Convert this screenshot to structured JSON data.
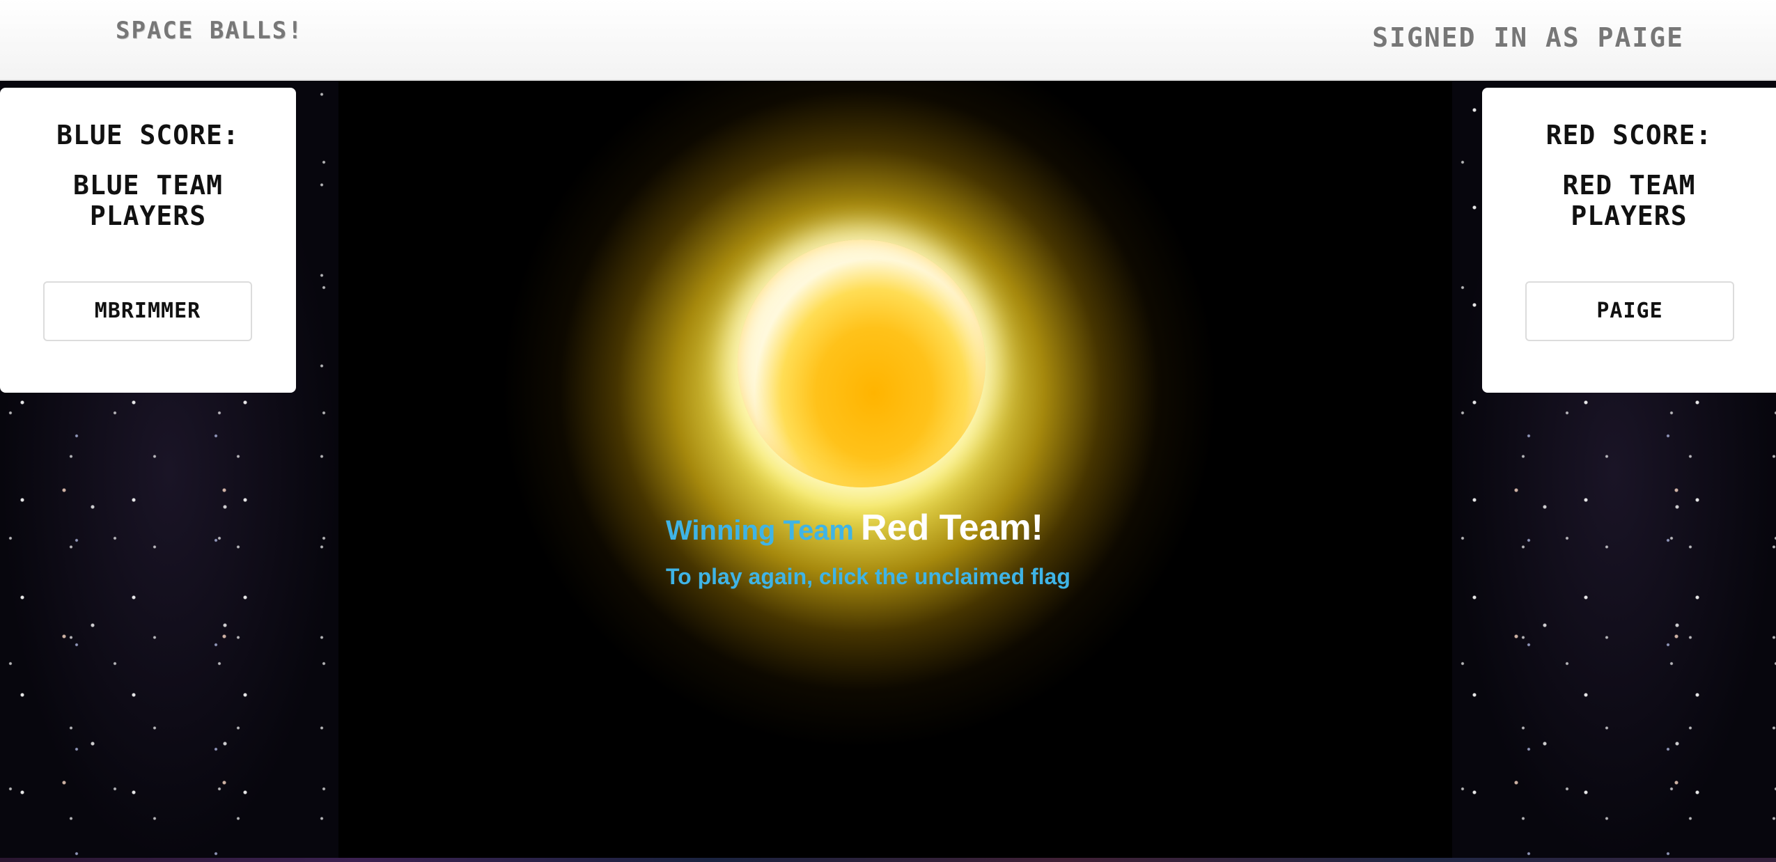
{
  "header": {
    "brand": "Space Balls!",
    "signed_in": "Signed in as paige"
  },
  "blue_panel": {
    "score_label": "Blue Score:",
    "players_title": "Blue Team Players",
    "players": [
      "mbrimmer"
    ]
  },
  "red_panel": {
    "score_label": "Red Score:",
    "players_title": "Red Team Players",
    "players": [
      "paige"
    ]
  },
  "game": {
    "winning_label": "Winning Team",
    "winning_team": "Red Team!",
    "play_again": "To play again, click the unclaimed flag"
  },
  "colors": {
    "accent_blue": "#3fb4e6",
    "glow_yellow": "#ffd21a",
    "header_text": "#777777"
  }
}
